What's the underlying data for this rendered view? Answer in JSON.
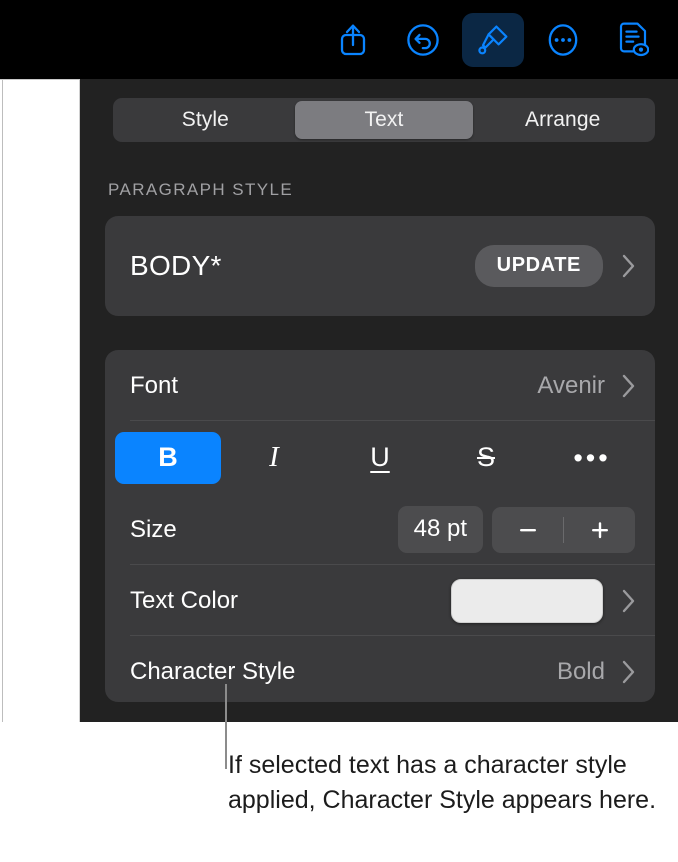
{
  "toolbar": {
    "buttons": [
      {
        "name": "share-icon",
        "label": "Share"
      },
      {
        "name": "undo-icon",
        "label": "Undo"
      },
      {
        "name": "format-brush-icon",
        "label": "Format",
        "active": true
      },
      {
        "name": "more-options-icon",
        "label": "More"
      },
      {
        "name": "document-options-icon",
        "label": "Document Options"
      }
    ]
  },
  "panel": {
    "tabs": [
      {
        "label": "Style",
        "selected": false
      },
      {
        "label": "Text",
        "selected": true
      },
      {
        "label": "Arrange",
        "selected": false
      }
    ],
    "section_label": "PARAGRAPH STYLE",
    "paragraph_style": {
      "name": "BODY*",
      "update_label": "UPDATE",
      "chevron": "chevron-right-icon"
    },
    "font": {
      "label": "Font",
      "value": "Avenir",
      "chevron": "chevron-right-icon"
    },
    "format_buttons": [
      {
        "name": "bold-button",
        "glyph": "B",
        "active": true
      },
      {
        "name": "italic-button",
        "glyph": "I",
        "active": false
      },
      {
        "name": "underline-button",
        "glyph": "U",
        "active": false
      },
      {
        "name": "strikethrough-button",
        "glyph": "S",
        "active": false
      },
      {
        "name": "more-format-button",
        "glyph": "•••",
        "active": false
      }
    ],
    "size": {
      "label": "Size",
      "value": "48 pt",
      "decrement": "−",
      "increment": "+"
    },
    "text_color": {
      "label": "Text Color",
      "swatch_color": "#ebebeb",
      "chevron": "chevron-right-icon"
    },
    "character_style": {
      "label": "Character Style",
      "value": "Bold",
      "chevron": "chevron-right-icon"
    }
  },
  "callout": {
    "text": "If selected text has a character style applied, Character Style appears here."
  },
  "colors": {
    "accent_blue": "#0a84ff",
    "toolbar_background": "#000000",
    "panel_background": "#222222",
    "card_background": "#3a3a3c"
  }
}
